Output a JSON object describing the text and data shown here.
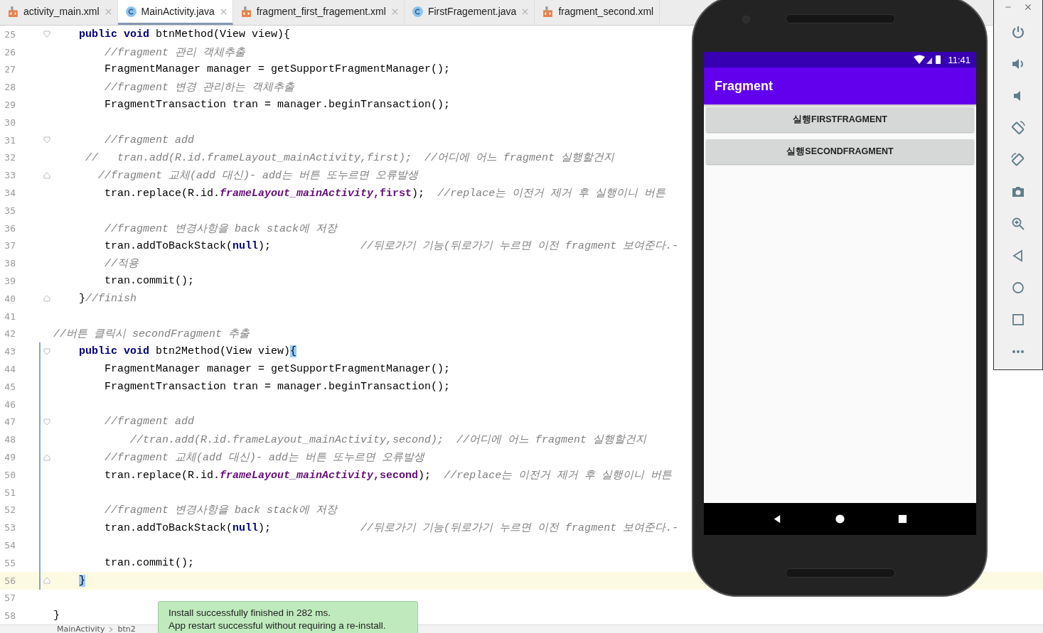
{
  "tabs": [
    {
      "label": "activity_main.xml",
      "kind": "xml",
      "selected": false,
      "closable": true
    },
    {
      "label": "MainActivity.java",
      "kind": "class",
      "selected": true,
      "closable": true
    },
    {
      "label": "fragment_first_fragement.xml",
      "kind": "xml",
      "selected": false,
      "closable": true
    },
    {
      "label": "FirstFragement.java",
      "kind": "class",
      "selected": false,
      "closable": true
    },
    {
      "label": "fragment_second.xml",
      "kind": "xml",
      "selected": false,
      "closable": false
    }
  ],
  "editor": {
    "lines": [
      {
        "number": "25",
        "fold_open": true,
        "fold_close": false,
        "changed": false,
        "current": false,
        "tokens": [
          {
            "kind": "k",
            "text": "    public void"
          },
          {
            "kind": "t",
            "text": " btnMethod(View view){"
          }
        ]
      },
      {
        "number": "26",
        "fold_open": false,
        "fold_close": false,
        "changed": false,
        "current": false,
        "tokens": [
          {
            "kind": "c",
            "text": "        //fragment 관리 객체추출"
          }
        ]
      },
      {
        "number": "27",
        "fold_open": false,
        "fold_close": false,
        "changed": false,
        "current": false,
        "tokens": [
          {
            "kind": "t",
            "text": "        FragmentManager manager = getSupportFragmentManager();"
          }
        ]
      },
      {
        "number": "28",
        "fold_open": false,
        "fold_close": false,
        "changed": false,
        "current": false,
        "tokens": [
          {
            "kind": "c",
            "text": "        //fragment 변경 관리하는 객체추출"
          }
        ]
      },
      {
        "number": "29",
        "fold_open": false,
        "fold_close": false,
        "changed": false,
        "current": false,
        "tokens": [
          {
            "kind": "t",
            "text": "        FragmentTransaction tran = manager.beginTransaction();"
          }
        ]
      },
      {
        "number": "30",
        "fold_open": false,
        "fold_close": false,
        "changed": false,
        "current": false
      },
      {
        "number": "31",
        "fold_open": true,
        "fold_close": false,
        "changed": false,
        "current": false,
        "tokens": [
          {
            "kind": "c",
            "text": "        //fragment add"
          }
        ]
      },
      {
        "number": "32",
        "fold_open": false,
        "fold_close": false,
        "changed": false,
        "current": false,
        "tokens": [
          {
            "kind": "c",
            "text": "     //   tran.add(R.id.frameLayout_mainActivity,first);  //어디에 어느 fragment 실행할건지"
          }
        ]
      },
      {
        "number": "33",
        "fold_open": false,
        "fold_close": true,
        "changed": false,
        "current": false,
        "tokens": [
          {
            "kind": "c",
            "text": "       //fragment 교체(add 대신)- add는 버튼 또누르면 오류발생"
          }
        ]
      },
      {
        "number": "34",
        "fold_open": false,
        "fold_close": false,
        "changed": false,
        "current": false,
        "tokens": [
          {
            "kind": "t",
            "text": "        tran.replace(R.id."
          },
          {
            "kind": "f",
            "text": "frameLayout_mainActivity"
          },
          {
            "kind": "b",
            "text": ",first"
          },
          {
            "kind": "t",
            "text": ");  "
          },
          {
            "kind": "c",
            "text": "//replace는 이전거 제거 후 실행이니 버튼"
          }
        ]
      },
      {
        "number": "35",
        "fold_open": false,
        "fold_close": false,
        "changed": false,
        "current": false
      },
      {
        "number": "36",
        "fold_open": false,
        "fold_close": false,
        "changed": false,
        "current": false,
        "tokens": [
          {
            "kind": "c",
            "text": "        //fragment 변경사항을 back stack에 저장"
          }
        ]
      },
      {
        "number": "37",
        "fold_open": false,
        "fold_close": false,
        "changed": false,
        "current": false,
        "tokens": [
          {
            "kind": "t",
            "text": "        tran.addToBackStack("
          },
          {
            "kind": "k",
            "text": "null"
          },
          {
            "kind": "t",
            "text": ");"
          },
          {
            "kind": "c",
            "text": "              //뒤로가기 기능(뒤로가기 누르면 이전 fragment 보여준다.-"
          }
        ]
      },
      {
        "number": "38",
        "fold_open": false,
        "fold_close": false,
        "changed": false,
        "current": false,
        "tokens": [
          {
            "kind": "c",
            "text": "        //적용"
          }
        ]
      },
      {
        "number": "39",
        "fold_open": false,
        "fold_close": false,
        "changed": false,
        "current": false,
        "tokens": [
          {
            "kind": "t",
            "text": "        tran.commit();"
          }
        ]
      },
      {
        "number": "40",
        "fold_open": false,
        "fold_close": true,
        "changed": false,
        "current": false,
        "tokens": [
          {
            "kind": "t",
            "text": "    }"
          },
          {
            "kind": "c",
            "text": "//finish"
          }
        ]
      },
      {
        "number": "41",
        "fold_open": false,
        "fold_close": false,
        "changed": false,
        "current": false
      },
      {
        "number": "42",
        "fold_open": false,
        "fold_close": false,
        "changed": false,
        "current": false,
        "tokens": [
          {
            "kind": "c",
            "text": "//버튼 클릭시 secondFragment 추출"
          }
        ]
      },
      {
        "number": "43",
        "fold_open": true,
        "fold_close": false,
        "changed": true,
        "current": false,
        "tokens": [
          {
            "kind": "k",
            "text": "    public void"
          },
          {
            "kind": "t",
            "text": " btn2Method(View view)"
          },
          {
            "kind": "h",
            "text": "{"
          }
        ]
      },
      {
        "number": "44",
        "fold_open": false,
        "fold_close": false,
        "changed": true,
        "current": false,
        "tokens": [
          {
            "kind": "t",
            "text": "        FragmentManager manager = getSupportFragmentManager();"
          }
        ]
      },
      {
        "number": "45",
        "fold_open": false,
        "fold_close": false,
        "changed": true,
        "current": false,
        "tokens": [
          {
            "kind": "t",
            "text": "        FragmentTransaction tran = manager.beginTransaction();"
          }
        ]
      },
      {
        "number": "46",
        "fold_open": false,
        "fold_close": false,
        "changed": true,
        "current": false
      },
      {
        "number": "47",
        "fold_open": true,
        "fold_close": false,
        "changed": true,
        "current": false,
        "tokens": [
          {
            "kind": "c",
            "text": "        //fragment add"
          }
        ]
      },
      {
        "number": "48",
        "fold_open": false,
        "fold_close": false,
        "changed": true,
        "current": false,
        "tokens": [
          {
            "kind": "c",
            "text": "            //tran.add(R.id.frameLayout_mainActivity,second);  //어디에 어느 fragment 실행할건지"
          }
        ]
      },
      {
        "number": "49",
        "fold_open": false,
        "fold_close": true,
        "changed": true,
        "current": false,
        "tokens": [
          {
            "kind": "c",
            "text": "        //fragment 교체(add 대신)- add는 버튼 또누르면 오류발생"
          }
        ]
      },
      {
        "number": "50",
        "fold_open": false,
        "fold_close": false,
        "changed": true,
        "current": false,
        "tokens": [
          {
            "kind": "t",
            "text": "        tran.replace(R.id."
          },
          {
            "kind": "f",
            "text": "frameLayout_mainActivity"
          },
          {
            "kind": "b",
            "text": ",second"
          },
          {
            "kind": "t",
            "text": ");  "
          },
          {
            "kind": "c",
            "text": "//replace는 이전거 제거 후 실행이니 버튼"
          }
        ]
      },
      {
        "number": "51",
        "fold_open": false,
        "fold_close": false,
        "changed": true,
        "current": false
      },
      {
        "number": "52",
        "fold_open": false,
        "fold_close": false,
        "changed": true,
        "current": false,
        "tokens": [
          {
            "kind": "c",
            "text": "        //fragment 변경사항을 back stack에 저장"
          }
        ]
      },
      {
        "number": "53",
        "fold_open": false,
        "fold_close": false,
        "changed": true,
        "current": false,
        "tokens": [
          {
            "kind": "t",
            "text": "        tran.addToBackStack("
          },
          {
            "kind": "k",
            "text": "null"
          },
          {
            "kind": "t",
            "text": ");"
          },
          {
            "kind": "c",
            "text": "              //뒤로가기 기능(뒤로가기 누르면 이전 fragment 보여준다.-"
          }
        ]
      },
      {
        "number": "54",
        "fold_open": false,
        "fold_close": false,
        "changed": true,
        "current": false
      },
      {
        "number": "55",
        "fold_open": false,
        "fold_close": false,
        "changed": true,
        "current": false,
        "tokens": [
          {
            "kind": "t",
            "text": "        tran.commit();"
          }
        ]
      },
      {
        "number": "56",
        "fold_open": false,
        "fold_close": true,
        "changed": true,
        "current": true,
        "tokens": [
          {
            "kind": "h",
            "text": "    }"
          }
        ]
      },
      {
        "number": "57",
        "fold_open": false,
        "fold_close": false,
        "changed": false,
        "current": false
      },
      {
        "number": "58",
        "fold_open": false,
        "fold_close": false,
        "changed": false,
        "current": false,
        "tokens": [
          {
            "kind": "t",
            "text": "}"
          }
        ]
      }
    ]
  },
  "breadcrumb": [
    "MainActivity",
    "btn2"
  ],
  "toast": {
    "lines": [
      "Install successfully finished in 282 ms.",
      "App restart successful without requiring a re-install."
    ]
  },
  "emulator": {
    "status_time": "11:41",
    "app_title": "Fragment",
    "buttons": [
      "실행FIRSTFRAGMENT",
      "실행SECONDFRAGMENT"
    ]
  }
}
